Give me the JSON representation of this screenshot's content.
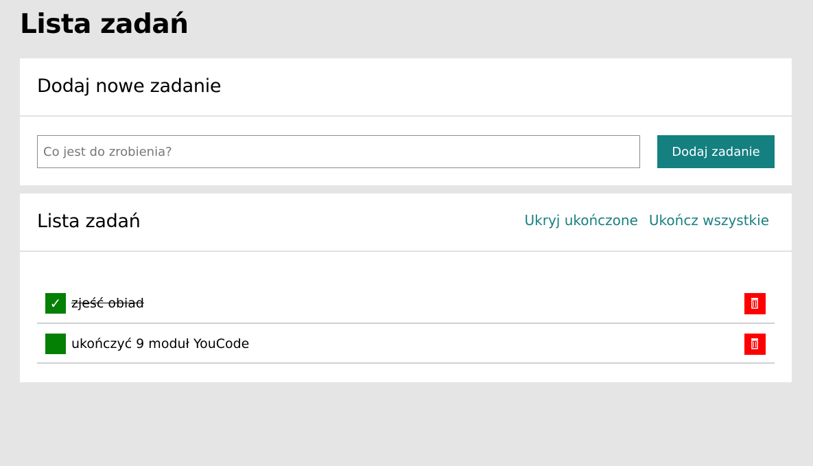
{
  "page": {
    "title": "Lista zadań"
  },
  "add_card": {
    "title": "Dodaj nowe zadanie",
    "input_placeholder": "Co jest do zrobienia?",
    "input_value": "",
    "button_label": "Dodaj zadanie"
  },
  "list_card": {
    "title": "Lista zadań",
    "hide_completed_label": "Ukryj ukończone",
    "complete_all_label": "Ukończ wszystkie",
    "tasks": [
      {
        "text": "zjeść obiad",
        "done": true,
        "check_glyph": "✓",
        "check_icon": "checkmark-icon",
        "delete_icon": "trash-icon"
      },
      {
        "text": "ukończyć 9 moduł YouCode",
        "done": false,
        "check_glyph": "",
        "check_icon": "checkbox-empty-icon",
        "delete_icon": "trash-icon"
      }
    ]
  },
  "colors": {
    "background": "#e5e5e5",
    "card": "#ffffff",
    "accent": "#148080",
    "link": "#1a7f7f",
    "check": "#048004",
    "delete": "#ff0000"
  }
}
